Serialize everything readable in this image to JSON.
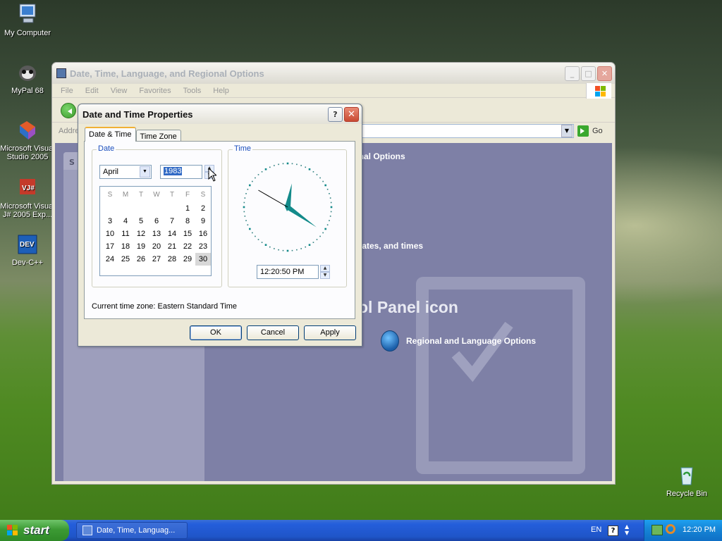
{
  "desktop": {
    "icons": [
      {
        "label": "My Computer"
      },
      {
        "label": "MyPal 68"
      },
      {
        "label": "Microsoft Visual Studio 2005"
      },
      {
        "label": "Microsoft Visual J# 2005 Exp..."
      },
      {
        "label": "Dev-C++"
      },
      {
        "label": "Recycle Bin"
      }
    ]
  },
  "explorer": {
    "title": "Date, Time, Language, and Regional Options",
    "menu": [
      "File",
      "Edit",
      "View",
      "Favorites",
      "Tools",
      "Help"
    ],
    "address_label": "Address",
    "go_label": "Go",
    "header_text": "ional Options",
    "task_text": "lates, and times",
    "panel_title": "ol Panel icon",
    "regional_link": "Regional and Language Options",
    "left_pane_letter": "S"
  },
  "dialog": {
    "title": "Date and Time Properties",
    "help_label": "?",
    "tabs": [
      "Date & Time",
      "Time Zone"
    ],
    "date_group": "Date",
    "time_group": "Time",
    "month": "April",
    "year": "1983",
    "weekdays": [
      "S",
      "M",
      "T",
      "W",
      "T",
      "F",
      "S"
    ],
    "weeks": [
      [
        "",
        "",
        "",
        "",
        "",
        "1",
        "2"
      ],
      [
        "3",
        "4",
        "5",
        "6",
        "7",
        "8",
        "9"
      ],
      [
        "10",
        "11",
        "12",
        "13",
        "14",
        "15",
        "16"
      ],
      [
        "17",
        "18",
        "19",
        "20",
        "21",
        "22",
        "23"
      ],
      [
        "24",
        "25",
        "26",
        "27",
        "28",
        "29",
        "30"
      ]
    ],
    "selected_day": "30",
    "time": "12:20:50 PM",
    "clock": {
      "hour": 12,
      "minute": 20,
      "second": 50
    },
    "timezone_label": "Current time zone:",
    "timezone_value": "Eastern Standard Time",
    "buttons": {
      "ok": "OK",
      "cancel": "Cancel",
      "apply": "Apply"
    }
  },
  "taskbar": {
    "start_label": "start",
    "task_item": "Date, Time, Languag...",
    "language": "EN",
    "help": "?",
    "clock": "12:20 PM"
  },
  "colors": {
    "clock_hands": "#138a8a",
    "selection": "#316ac5",
    "taskbar": "#245edb",
    "start_button": "#3c9a34"
  }
}
